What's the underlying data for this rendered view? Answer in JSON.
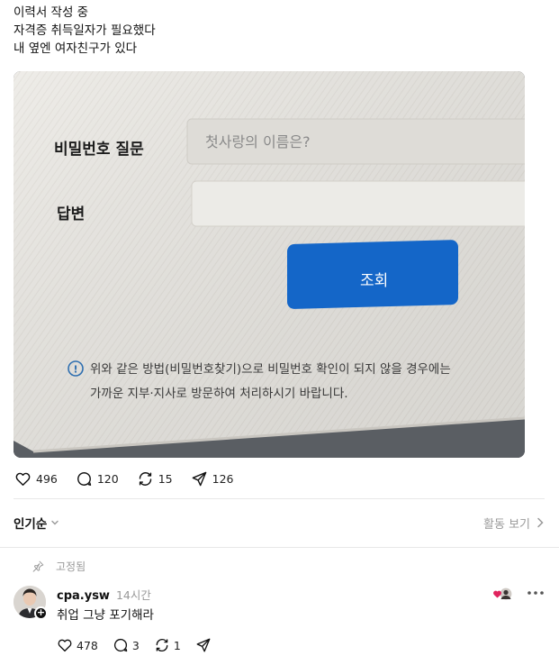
{
  "post": {
    "lines": [
      "이력서 작성 중",
      "자격증 취득일자가 필요했다",
      "내 옆엔 여자친구가 있다"
    ]
  },
  "photo": {
    "question_label": "비밀번호 질문",
    "question_value": "첫사랑의 이름은?",
    "answer_label": "답변",
    "button_label": "조회",
    "notice_line1": "위와 같은 방법(비밀번호찾기)으로 비밀번호 확인이 되지 않을 경우에는",
    "notice_line2": "가까운 지부·지사로 방문하여 처리하시기 바랍니다."
  },
  "actions": {
    "likes": "496",
    "comments": "120",
    "reposts": "15",
    "shares": "126"
  },
  "sort": {
    "label": "인기순",
    "activity_label": "활동 보기"
  },
  "comment": {
    "pinned_label": "고정됨",
    "username": "cpa.ysw",
    "time": "14시간",
    "text": "취업 그냥 포기해라",
    "likes": "478",
    "replies": "3",
    "reposts": "1"
  },
  "colors": {
    "button_blue": "#1466c8",
    "heart_red": "#e0245e"
  }
}
